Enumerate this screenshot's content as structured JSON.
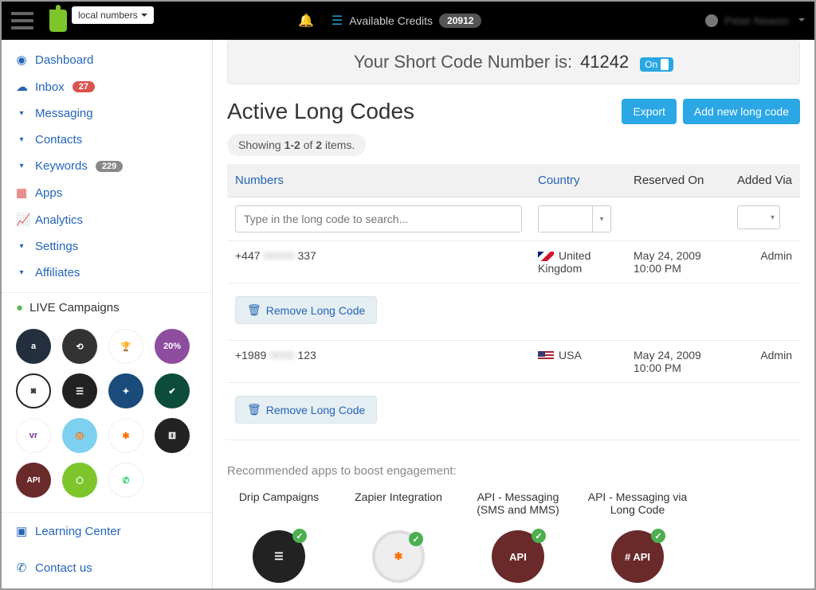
{
  "header": {
    "local_numbers": "local numbers",
    "credits_label": "Available Credits",
    "credits_value": "20912",
    "username": "Peter Newon"
  },
  "sidebar": {
    "items": [
      {
        "icon": "tachometer",
        "label": "Dashboard"
      },
      {
        "icon": "inbox",
        "label": "Inbox",
        "badge_red": "27"
      },
      {
        "icon": "caret",
        "label": "Messaging"
      },
      {
        "icon": "caret",
        "label": "Contacts"
      },
      {
        "icon": "caret",
        "label": "Keywords",
        "badge_grey": "229"
      },
      {
        "icon": "grid",
        "label": "Apps"
      },
      {
        "icon": "chart",
        "label": "Analytics"
      },
      {
        "icon": "caret",
        "label": "Settings"
      },
      {
        "icon": "caret",
        "label": "Affiliates"
      }
    ],
    "live_label": "LIVE Campaigns",
    "footer": {
      "learning": "Learning Center",
      "contact": "Contact us"
    }
  },
  "shortcode": {
    "title": "Your Short Code Number is:",
    "number": "41242",
    "toggle": "On"
  },
  "page": {
    "title": "Active Long Codes",
    "export": "Export",
    "add_new": "Add new long code",
    "showing_prefix": "Showing ",
    "showing_strong1": "1-2",
    "showing_mid": " of ",
    "showing_strong2": "2",
    "showing_suffix": " items."
  },
  "table": {
    "headers": {
      "numbers": "Numbers",
      "country": "Country",
      "reserved": "Reserved On",
      "added": "Added Via"
    },
    "search_placeholder": "Type in the long code to search...",
    "rows": [
      {
        "prefix": "+447",
        "suffix": "337",
        "country": "United Kingdom",
        "flag": "uk",
        "reserved": "May 24, 2009 10:00 PM",
        "added": "Admin"
      },
      {
        "prefix": "+1989",
        "suffix": "123",
        "country": "USA",
        "flag": "us",
        "reserved": "May 24, 2009 10:00 PM",
        "added": "Admin"
      }
    ],
    "remove_label": "Remove Long Code"
  },
  "recommend": {
    "title": "Recommended apps to boost engagement:",
    "apps": [
      {
        "name": "Drip Campaigns"
      },
      {
        "name": "Zapier Integration"
      },
      {
        "name": "API - Messaging (SMS and MMS)"
      },
      {
        "name": "API - Messaging via Long Code"
      }
    ]
  }
}
